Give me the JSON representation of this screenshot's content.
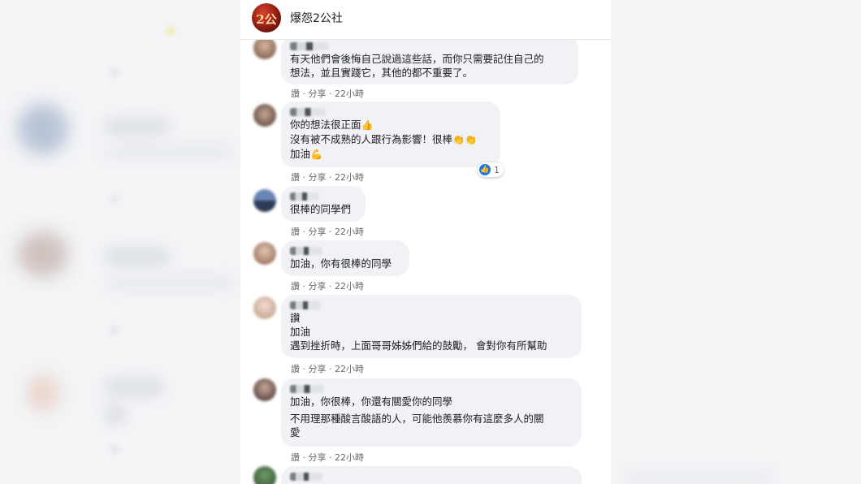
{
  "page": {
    "name": "爆怨2公社",
    "logo_text": "2公"
  },
  "comments": [
    {
      "lines": [
        "有天他們會後悔自己說過這些話，而你只需要記住自己的",
        "想法，並且實踐它，其他的都不重要了。"
      ],
      "actions": {
        "like": "讚",
        "share": "分享",
        "time": "22小時"
      }
    },
    {
      "lines": [
        "你的想法很正面",
        "沒有被不成熟的人跟行為影響！很棒",
        "加油"
      ],
      "emojis": [
        "👍",
        "👏👏",
        "💪"
      ],
      "actions": {
        "like": "讚",
        "share": "分享",
        "time": "22小時"
      },
      "reaction": {
        "icon": "👍",
        "count": "1"
      }
    },
    {
      "lines": [
        "很棒的同學們"
      ],
      "actions": {
        "like": "讚",
        "share": "分享",
        "time": "22小時"
      }
    },
    {
      "lines": [
        "加油，你有很棒的同學"
      ],
      "actions": {
        "like": "讚",
        "share": "分享",
        "time": "22小時"
      }
    },
    {
      "lines": [
        "讚",
        "加油",
        "遇到挫折時，上面哥哥姊姊們給的鼓勵， 會對你有所幫助"
      ],
      "actions": {
        "like": "讚",
        "share": "分享",
        "time": "22小時"
      }
    },
    {
      "lines": [
        "加油，你很棒，你還有關愛你的同學",
        "不用理那種酸言酸語的人，可能他羨慕你有這麼多人的關",
        "愛"
      ],
      "actions": {
        "like": "讚",
        "share": "分享",
        "time": "22小時"
      }
    }
  ],
  "colors": {
    "bubble": "#f0f2f5",
    "meta_text": "#65676b",
    "like_blue": "#1877f2"
  }
}
